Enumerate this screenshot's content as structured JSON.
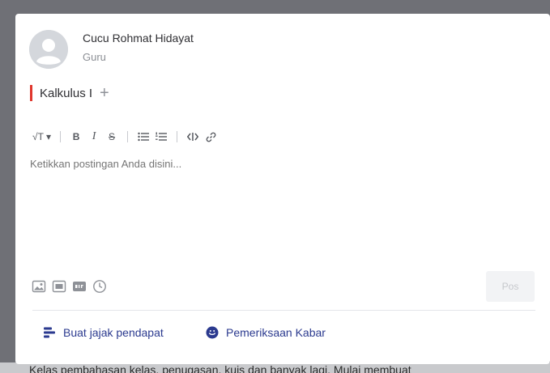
{
  "post_author": {
    "name": "Cucu Rohmat Hidayat",
    "role": "Guru"
  },
  "class_tag": {
    "name": "Kalkulus I",
    "add_symbol": "+"
  },
  "toolbar": {
    "text_size": "√T ▾",
    "bold": "B",
    "italic": "I",
    "strike": "S",
    "bullet_list": "☰",
    "numbered_list": "≣",
    "code": "‹›",
    "link": "🔗"
  },
  "editor": {
    "placeholder": "Ketikkan postingan Anda disini..."
  },
  "attachments": [
    "image-icon",
    "video-icon",
    "gif-icon",
    "clock-icon"
  ],
  "post_button": {
    "label": "Pos"
  },
  "actions": {
    "poll_label": "Buat jajak pendapat",
    "checkin_label": "Pemeriksaan Kabar"
  },
  "backdrop": {
    "text": "Kelas pembahasan kelas, penugasan, kuis dan banyak lagi. Mulai membuat"
  },
  "colors": {
    "accent_red": "#e0372d",
    "action_blue": "#2b3a8f"
  }
}
